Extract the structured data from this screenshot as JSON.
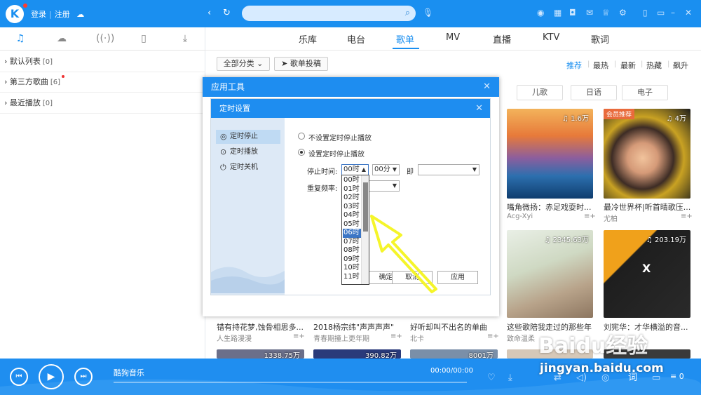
{
  "topbar": {
    "login": "登录",
    "register": "注册",
    "search_placeholder": ""
  },
  "sidebar": {
    "tabs": [
      "music-note-icon",
      "cloud-icon",
      "radio-icon",
      "device-icon",
      "download-icon"
    ],
    "items": [
      {
        "label": "默认列表",
        "count": "[0]"
      },
      {
        "label": "第三方歌曲",
        "count": "[6]"
      },
      {
        "label": "最近播放",
        "count": "[0]"
      }
    ]
  },
  "nav": {
    "tabs": [
      "乐库",
      "电台",
      "歌单",
      "MV",
      "直播",
      "KTV",
      "歌词"
    ],
    "active": "歌单"
  },
  "filters": {
    "category": "全部分类",
    "submit": "歌单投稿",
    "sort": [
      "推荐",
      "最热",
      "最新",
      "热藏",
      "飙升"
    ],
    "tags": [
      "儿歌",
      "日语",
      "电子"
    ]
  },
  "cards": [
    {
      "title": "嘴角微扬：赤足戏耍时...",
      "author": "Acg-Xyi",
      "plays": "1.6万"
    },
    {
      "title": "最冷世界杯|听首晴歌压...",
      "author": "尤柏",
      "plays": "4万",
      "badge": "会员推荐"
    },
    {
      "title": "这些歌陪我走过的那些年",
      "author": "致命温柔",
      "plays": "2345.63万"
    },
    {
      "title": "刘宪华：才华横溢的音...",
      "author": "",
      "plays": "203.19万"
    },
    {
      "title": "错有持花梦,蚀骨相思多...",
      "author": "人生路漫漫"
    },
    {
      "title": "2018杨宗纬\"声声声声\"",
      "author": "青春期撞上更年期"
    },
    {
      "title": "好听却叫不出名的单曲",
      "author": "北卡"
    }
  ],
  "bottom_plays": [
    "1338.75万",
    "390.82万",
    "8001万"
  ],
  "dialog": {
    "outer_title": "应用工具",
    "inner_title": "定时设置",
    "side_items": [
      "定时停止",
      "定时播放",
      "定时关机"
    ],
    "options": [
      "不设置定时停止播放",
      "设置定时停止播放"
    ],
    "stop_time_label": "停止时间:",
    "hour_value": "00时",
    "minute_value": "00分",
    "ji": "即",
    "repeat_label": "重复频率:",
    "hours": [
      "00时",
      "01时",
      "02时",
      "03时",
      "04时",
      "05时",
      "06时",
      "07时",
      "08时",
      "09时",
      "10时",
      "11时"
    ],
    "highlighted_hour": "06时",
    "buttons": [
      "确定",
      "取消",
      "应用"
    ]
  },
  "player": {
    "title": "酷狗音乐",
    "time": "00:00/00:00",
    "lyric": "词",
    "queue_count": "0"
  },
  "watermark": {
    "text": "jingyan.baidu.com",
    "logo": "Baidu经验"
  },
  "colors": {
    "accent": "#1a8ff0",
    "annotation": "#f5f52a"
  }
}
